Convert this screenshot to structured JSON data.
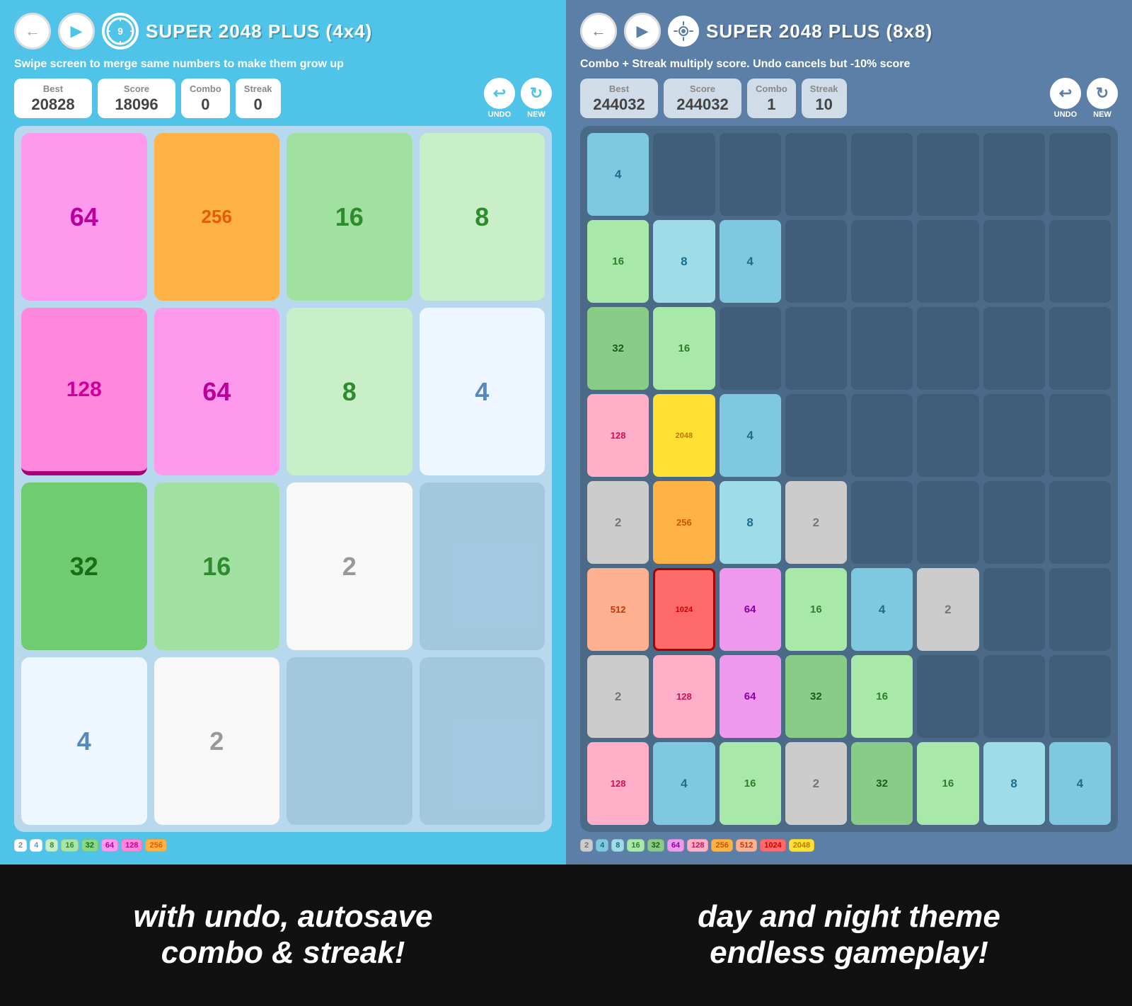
{
  "left": {
    "title": "SUPER 2048 PLUS  (4x4)",
    "subtitle": "Swipe screen to merge same numbers to make them grow up",
    "best_label": "Best",
    "best_value": "20828",
    "score_label": "Score",
    "score_value": "18096",
    "combo_label": "Combo",
    "combo_value": "0",
    "streak_label": "Streak",
    "streak_value": "0",
    "undo_label": "UNDO",
    "new_label": "NEW",
    "banner": "with undo, autosave\ncombo & streak!",
    "grid": [
      [
        "64",
        "256",
        "16",
        "8"
      ],
      [
        "128",
        "64",
        "8",
        "4"
      ],
      [
        "32",
        "16",
        "2",
        ""
      ],
      [
        "4",
        "2",
        "",
        ""
      ]
    ],
    "legend": [
      {
        "val": "2",
        "bg": "#FFFFFF",
        "color": "#888"
      },
      {
        "val": "4",
        "bg": "#FFFFFF",
        "color": "#5B99CC"
      },
      {
        "val": "8",
        "bg": "#C8EFC8",
        "color": "#2E8B2E"
      },
      {
        "val": "16",
        "bg": "#A8E6A8",
        "color": "#2E8B2E"
      },
      {
        "val": "32",
        "bg": "#88D888",
        "color": "#1A6E1A"
      },
      {
        "val": "64",
        "bg": "#FF99EE",
        "color": "#BB0099"
      },
      {
        "val": "128",
        "bg": "#FF88DD",
        "color": "#CC0099"
      },
      {
        "val": "256",
        "bg": "#FFB347",
        "color": "#E65C00"
      }
    ]
  },
  "right": {
    "title": "SUPER 2048 PLUS  (8x8)",
    "subtitle": "Combo + Streak multiply score. Undo cancels but -10% score",
    "best_label": "Best",
    "best_value": "244032",
    "score_label": "Score",
    "score_value": "244032",
    "combo_label": "Combo",
    "combo_value": "1",
    "streak_label": "Streak",
    "streak_value": "10",
    "undo_label": "UNDO",
    "new_label": "NEW",
    "banner": "day and night theme\nendless gameplay!",
    "grid": [
      [
        "4",
        "",
        "",
        "",
        "",
        "",
        "",
        ""
      ],
      [
        "16",
        "8",
        "4",
        "",
        "",
        "",
        "",
        ""
      ],
      [
        "32",
        "16",
        "",
        "",
        "",
        "",
        "",
        ""
      ],
      [
        "128",
        "2048",
        "4",
        "",
        "",
        "",
        "",
        ""
      ],
      [
        "2",
        "256",
        "8",
        "2",
        "",
        "",
        "",
        ""
      ],
      [
        "512",
        "1024",
        "64",
        "16",
        "4",
        "2",
        "",
        ""
      ],
      [
        "2",
        "128",
        "64",
        "32",
        "16",
        "",
        "",
        ""
      ],
      [
        "128",
        "4",
        "16",
        "2",
        "32",
        "16",
        "8",
        "4"
      ]
    ],
    "legend": [
      {
        "val": "2",
        "bg": "#CCCCCC",
        "color": "#777"
      },
      {
        "val": "4",
        "bg": "#7EC8E0",
        "color": "#1A6E8E"
      },
      {
        "val": "8",
        "bg": "#9EDCE8",
        "color": "#1A6E8E"
      },
      {
        "val": "16",
        "bg": "#A8E8A8",
        "color": "#2E7E2E"
      },
      {
        "val": "32",
        "bg": "#88CC88",
        "color": "#1A5E1A"
      },
      {
        "val": "64",
        "bg": "#EE99EE",
        "color": "#8800AA"
      },
      {
        "val": "128",
        "bg": "#FFB0C8",
        "color": "#CC1155"
      },
      {
        "val": "256",
        "bg": "#FFB347",
        "color": "#CC5500"
      },
      {
        "val": "512",
        "bg": "#FFB090",
        "color": "#CC3300"
      },
      {
        "val": "1024",
        "bg": "#FF6B6B",
        "color": "#CC0000"
      },
      {
        "val": "2048",
        "bg": "#FFE033",
        "color": "#BB7700"
      }
    ]
  }
}
